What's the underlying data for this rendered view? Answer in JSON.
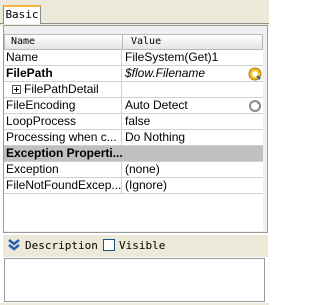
{
  "tabs": [
    {
      "label": "Basic",
      "active": true
    }
  ],
  "grid": {
    "header": {
      "name": "Name",
      "value": "Value"
    },
    "rows": [
      {
        "name": "Name",
        "value": "FileSystem(Get)1"
      },
      {
        "name": "FilePath",
        "value": "$flow.Filename"
      },
      {
        "name": "FilePathDetail",
        "value": ""
      },
      {
        "name": "FileEncoding",
        "value": "Auto Detect"
      },
      {
        "name": "LoopProcess",
        "value": "false"
      },
      {
        "name": "Processing when c...",
        "value": "Do Nothing"
      },
      {
        "name": "Exception Properti...",
        "value": ""
      },
      {
        "name": "Exception",
        "value": "(none)"
      },
      {
        "name": "FileNotFoundExcep...",
        "value": "(Ignore)"
      }
    ]
  },
  "description_bar": {
    "label": "Description",
    "visible_label": "Visible",
    "visible_checked": false
  },
  "icons": {
    "filepath_button": "flow-variable-icon",
    "encoding_button": "refresh-icon",
    "collapse": "chevron-double-down-icon"
  },
  "colors": {
    "tab_accent": "#f5b440",
    "section_bg": "#c0c0c0",
    "chevron": "#2a5fb0"
  }
}
